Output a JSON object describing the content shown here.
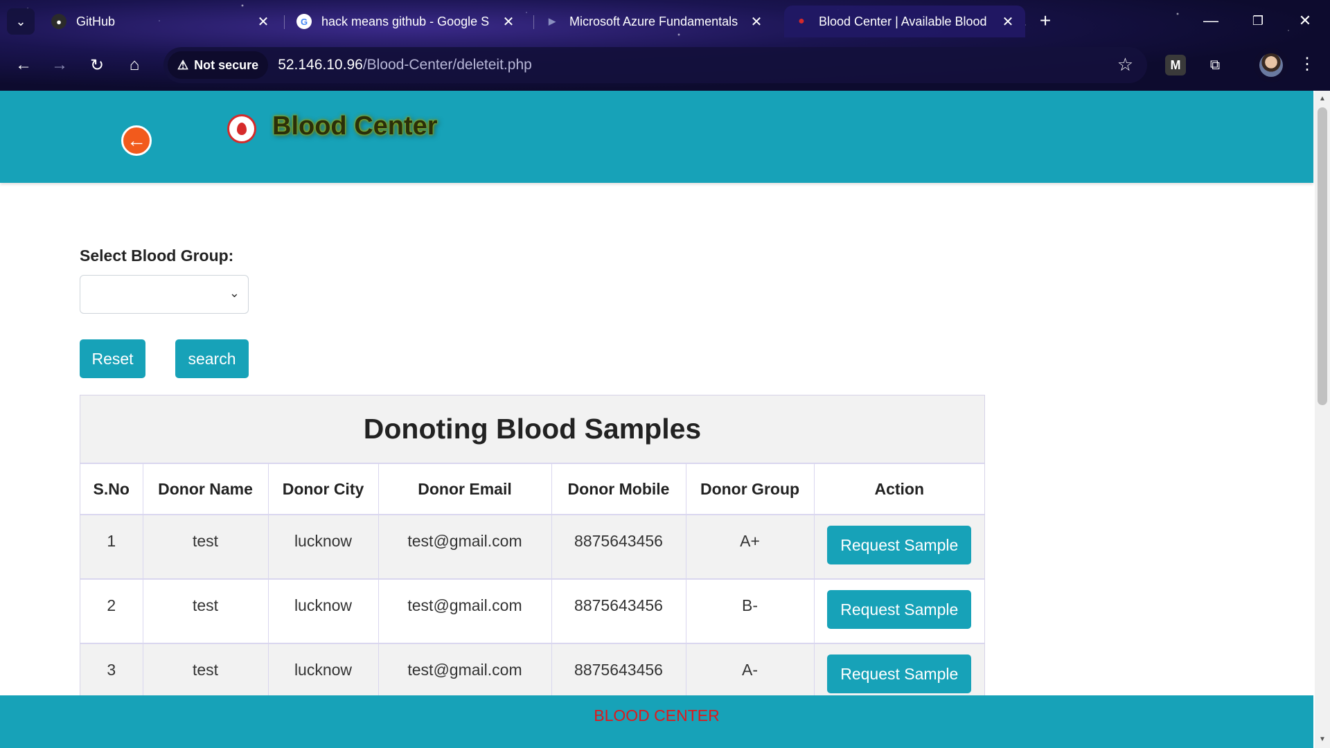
{
  "browser": {
    "tabs": [
      {
        "title": "GitHub",
        "favicon": "github-icon"
      },
      {
        "title": "hack means github - Google S",
        "favicon": "google-icon"
      },
      {
        "title": "Microsoft Azure Fundamentals",
        "favicon": "azure-icon"
      },
      {
        "title": "Blood Center | Available Blood",
        "favicon": "blood-drop-icon",
        "active": true
      }
    ],
    "security_label": "Not secure",
    "url_host": "52.146.10.96",
    "url_path": "/Blood-Center/deleteit.php"
  },
  "header": {
    "brand": "Blood Center"
  },
  "filter": {
    "label": "Select Blood Group:",
    "selected": "",
    "reset_label": "Reset",
    "search_label": "search"
  },
  "panel": {
    "title": "Donoting Blood Samples",
    "columns": [
      "S.No",
      "Donor Name",
      "Donor City",
      "Donor Email",
      "Donor Mobile",
      "Donor Group",
      "Action"
    ],
    "rows": [
      {
        "sno": "1",
        "name": "test",
        "city": "lucknow",
        "email": "test@gmail.com",
        "mobile": "8875643456",
        "group": "A+",
        "action": "Request Sample"
      },
      {
        "sno": "2",
        "name": "test",
        "city": "lucknow",
        "email": "test@gmail.com",
        "mobile": "8875643456",
        "group": "B-",
        "action": "Request Sample"
      },
      {
        "sno": "3",
        "name": "test",
        "city": "lucknow",
        "email": "test@gmail.com",
        "mobile": "8875643456",
        "group": "A-",
        "action": "Request Sample"
      }
    ]
  },
  "footer": {
    "text": "BLOOD CENTER"
  },
  "colors": {
    "accent": "#17a2b8",
    "footer_text": "#e0181b",
    "back_button": "#f25a1c"
  }
}
